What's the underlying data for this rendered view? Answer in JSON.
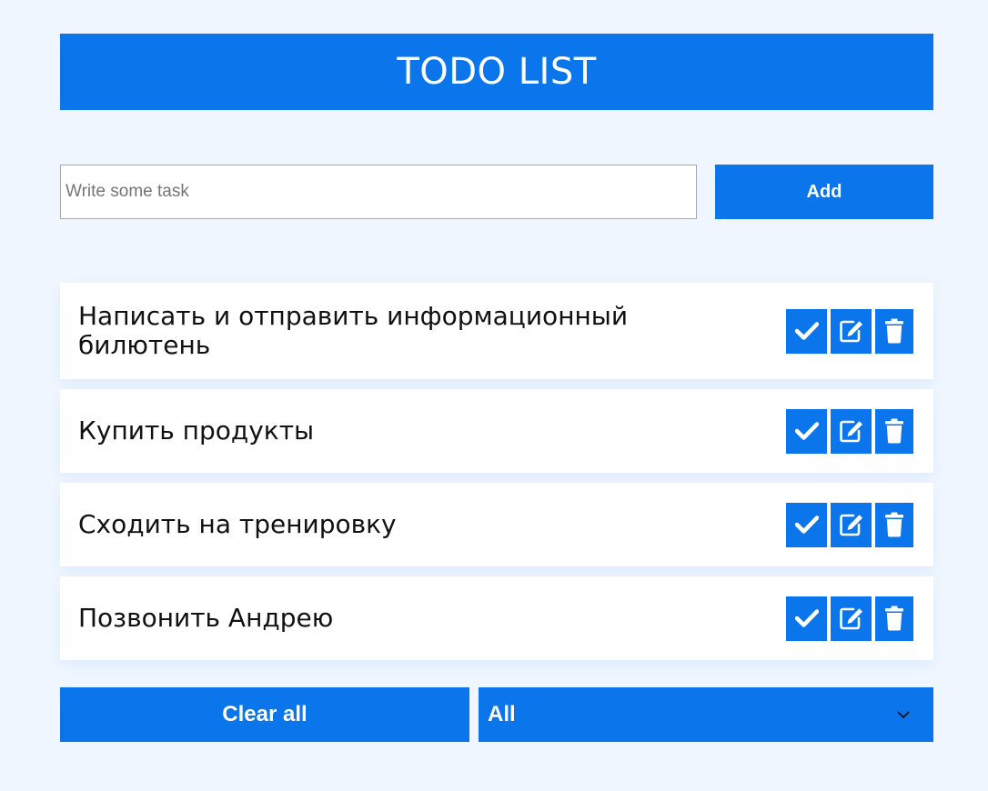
{
  "header": {
    "title": "TODO LIST"
  },
  "form": {
    "placeholder": "Write some task",
    "value": "",
    "add_label": "Add"
  },
  "tasks": [
    {
      "text": "Написать и отправить информационный билютень"
    },
    {
      "text": "Купить продукты"
    },
    {
      "text": "Сходить на тренировку"
    },
    {
      "text": "Позвонить Андрею"
    }
  ],
  "task_actions": {
    "complete_icon": "check-icon",
    "edit_icon": "edit-icon",
    "delete_icon": "trash-icon"
  },
  "footer": {
    "clear_label": "Clear all",
    "filter_selected": "All"
  },
  "colors": {
    "accent": "#0b75ec",
    "background": "#eff6ff"
  }
}
